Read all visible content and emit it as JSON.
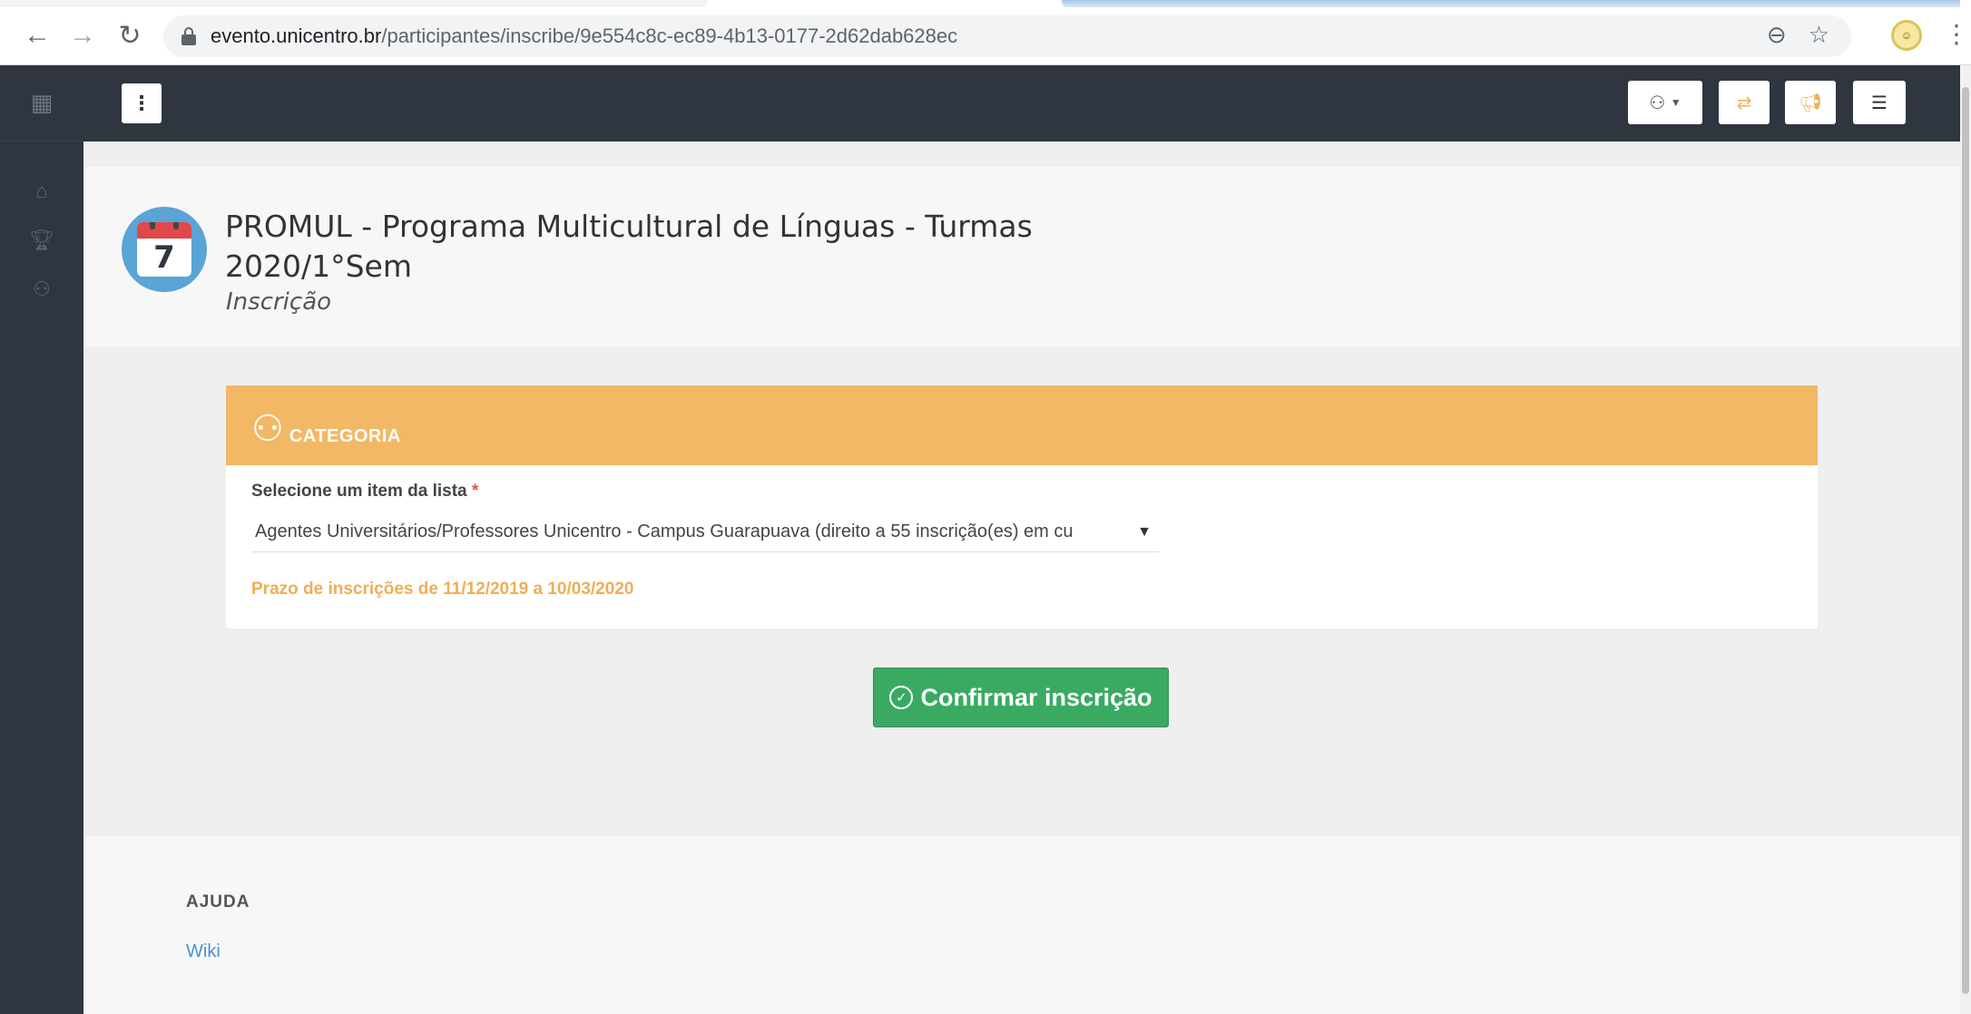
{
  "browser": {
    "url_host": "evento.unicentro.br",
    "url_path": "/participantes/inscribe/9e554c8c-ec89-4b13-0177-2d62dab628ec"
  },
  "sidebar": {
    "items": [
      {
        "icon": "home-icon"
      },
      {
        "icon": "trophy-icon"
      },
      {
        "icon": "users-icon"
      }
    ]
  },
  "event": {
    "calendar_day": "7",
    "title": "PROMUL - Programa Multicultural de Línguas - Turmas 2020/1°Sem",
    "subtitle": "Inscrição"
  },
  "category_card": {
    "title": "CATEGORIA",
    "field_label": "Selecione um item da lista",
    "required_mark": "*",
    "selected_value": "Agentes Universitários/Professores Unicentro - Campus Guarapuava (direito a 55 inscrição(es) em cu",
    "deadline": "Prazo de inscrições de 11/12/2019 a 10/03/2020"
  },
  "actions": {
    "confirm_label": "Confirmar inscrição"
  },
  "footer": {
    "help_title": "AJUDA",
    "wiki_label": "Wiki"
  },
  "colors": {
    "sidebar_bg": "#2f3640",
    "card_header": "#f2b866",
    "confirm_button": "#3aaa63",
    "deadline_text": "#f0ad55",
    "link": "#4a8fd6"
  }
}
